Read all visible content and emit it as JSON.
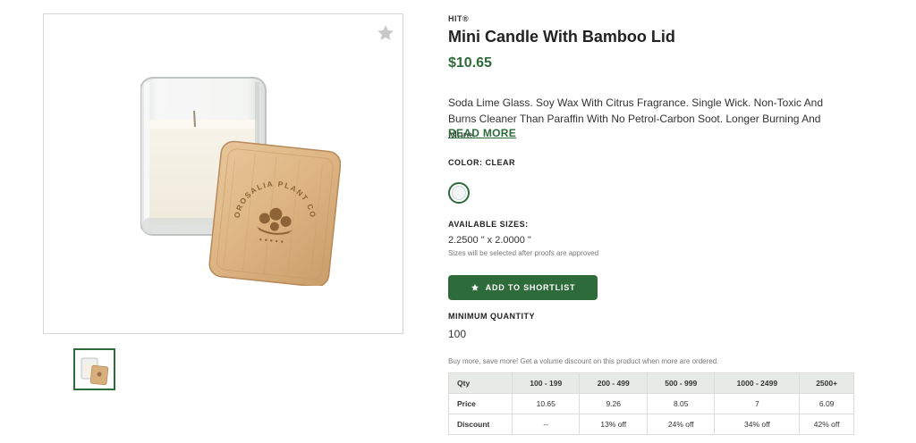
{
  "product": {
    "brand": "HIT®",
    "title": "Mini Candle With Bamboo Lid",
    "price": "$10.65",
    "description": "Soda Lime Glass. Soy Wax With Citrus Fragrance. Single Wick. Non-Toxic And Burns Cleaner Than Paraffin With No Petrol-Carbon Soot. Longer Burning And More...",
    "read_more": "READ MORE",
    "lid_engraving": "OROSALIA PLANT CO"
  },
  "color": {
    "label": "COLOR: CLEAR",
    "swatch_hex": "#f3f6f8"
  },
  "sizes": {
    "label": "AVAILABLE SIZES:",
    "value": "2.2500 \" x 2.0000 \"",
    "note": "Sizes will be selected after proofs are approved"
  },
  "actions": {
    "shortlist_label": "ADD TO SHORTLIST"
  },
  "minimum": {
    "label": "MINIMUM QUANTITY",
    "value": "100"
  },
  "pricing": {
    "note": "Buy more, save more! Get a volume discount on this product when more are ordered.",
    "header": [
      "Qty",
      "100 - 199",
      "200 - 499",
      "500 - 999",
      "1000 - 2499",
      "2500+"
    ],
    "price_row": [
      "Price",
      "10.65",
      "9.26",
      "8.05",
      "7",
      "6.09"
    ],
    "discount_row": [
      "Discount",
      "--",
      "13% off",
      "24% off",
      "34% off",
      "42% off"
    ]
  },
  "icons": {
    "favorite": "star-icon",
    "shortlist": "star-icon"
  },
  "colors": {
    "brand_green": "#2e6b3a",
    "table_header_bg": "#e6ebe7"
  }
}
